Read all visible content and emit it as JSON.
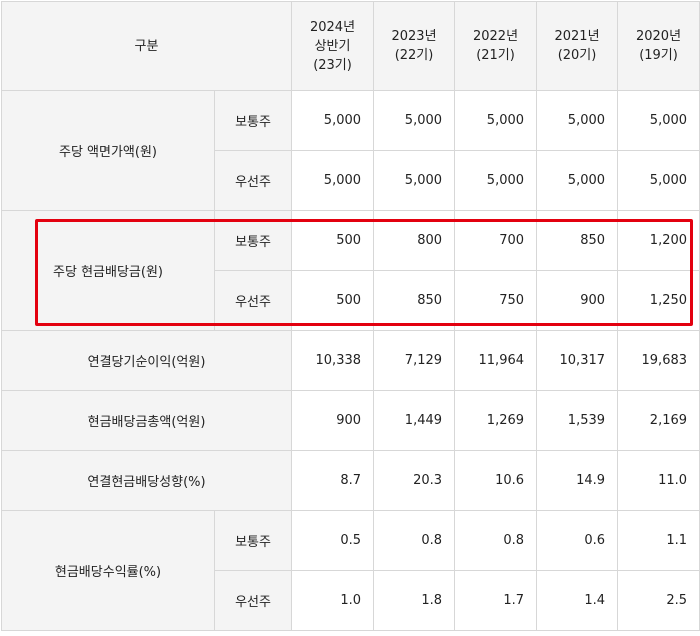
{
  "header": {
    "category": "구분",
    "years": [
      {
        "line1": "2024년",
        "line2": "상반기",
        "line3": "(23기)"
      },
      {
        "line1": "2023년",
        "line2": "(22기)"
      },
      {
        "line1": "2022년",
        "line2": "(21기)"
      },
      {
        "line1": "2021년",
        "line2": "(20기)"
      },
      {
        "line1": "2020년",
        "line2": "(19기)"
      }
    ]
  },
  "rows": {
    "par_value": {
      "label": "주당 액면가액(원)",
      "common": {
        "label": "보통주",
        "values": [
          "5,000",
          "5,000",
          "5,000",
          "5,000",
          "5,000"
        ]
      },
      "preferred": {
        "label": "우선주",
        "values": [
          "5,000",
          "5,000",
          "5,000",
          "5,000",
          "5,000"
        ]
      }
    },
    "cash_dividend": {
      "label": "주당 현금배당금(원)",
      "common": {
        "label": "보통주",
        "values": [
          "500",
          "800",
          "700",
          "850",
          "1,200"
        ]
      },
      "preferred": {
        "label": "우선주",
        "values": [
          "500",
          "850",
          "750",
          "900",
          "1,250"
        ]
      }
    },
    "net_income": {
      "label": "연결당기순이익(억원)",
      "values": [
        "10,338",
        "7,129",
        "11,964",
        "10,317",
        "19,683"
      ]
    },
    "total_dividend": {
      "label": "현금배당금총액(억원)",
      "values": [
        "900",
        "1,449",
        "1,269",
        "1,539",
        "2,169"
      ]
    },
    "payout_ratio": {
      "label": "연결현금배당성향(%)",
      "values": [
        "8.7",
        "20.3",
        "10.6",
        "14.9",
        "11.0"
      ]
    },
    "dividend_yield": {
      "label": "현금배당수익률(%)",
      "common": {
        "label": "보통주",
        "values": [
          "0.5",
          "0.8",
          "0.8",
          "0.6",
          "1.1"
        ]
      },
      "preferred": {
        "label": "우선주",
        "values": [
          "1.0",
          "1.8",
          "1.7",
          "1.4",
          "2.5"
        ]
      }
    }
  },
  "highlight_color": "#e3000f"
}
